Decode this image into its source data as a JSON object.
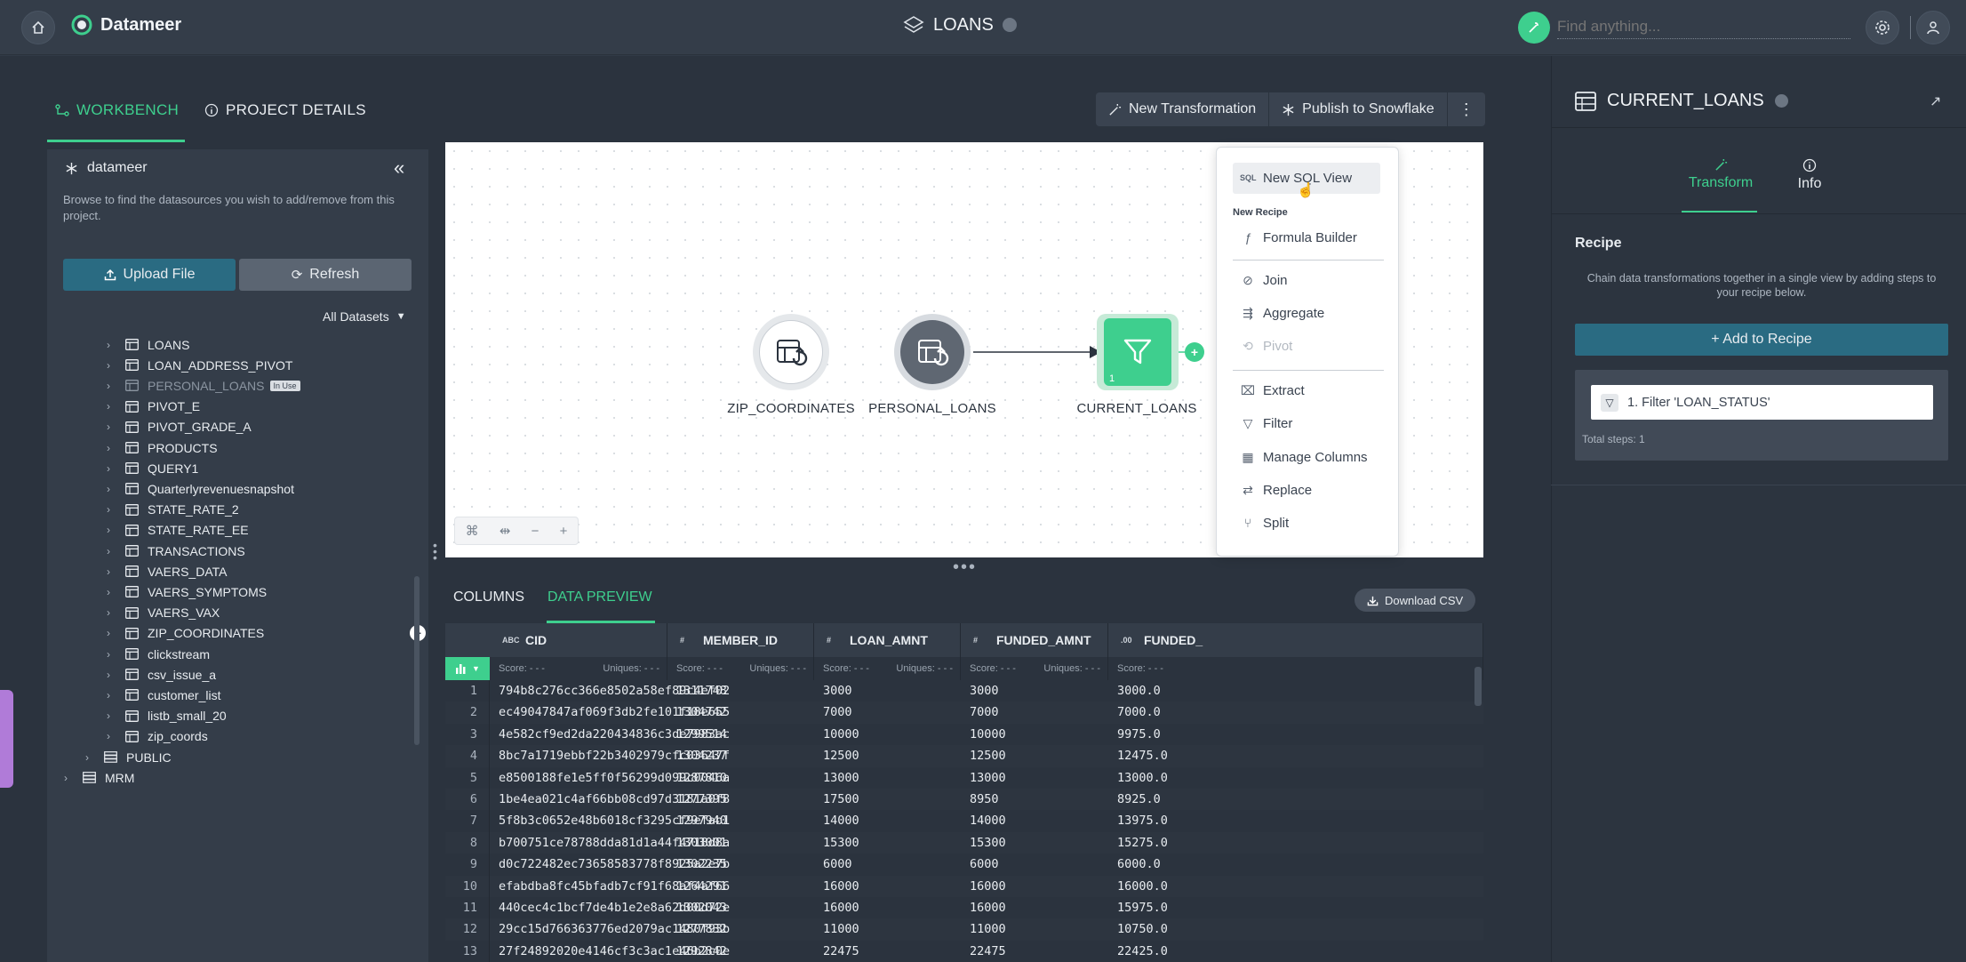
{
  "app": {
    "name": "Datameer",
    "project_title": "LOANS",
    "search_placeholder": "Find anything..."
  },
  "nav": {
    "tabs": [
      {
        "label": "WORKBENCH"
      },
      {
        "label": "PROJECT DETAILS"
      }
    ]
  },
  "toolbar": {
    "new_transformation": "New Transformation",
    "publish": "Publish to Snowflake"
  },
  "sidebar": {
    "title": "datameer",
    "description": "Browse to find the datasources you wish to add/remove from this project.",
    "upload_label": "Upload File",
    "refresh_label": "Refresh",
    "filter_label": "All Datasets",
    "in_use_badge": "In Use",
    "datasets": [
      "LOANS",
      "LOAN_ADDRESS_PIVOT",
      "PERSONAL_LOANS",
      "PIVOT_E",
      "PIVOT_GRADE_A",
      "PRODUCTS",
      "QUERY1",
      "Quarterlyrevenuesnapshot",
      "STATE_RATE_2",
      "STATE_RATE_EE",
      "TRANSACTIONS",
      "VAERS_DATA",
      "VAERS_SYMPTOMS",
      "VAERS_VAX",
      "ZIP_COORDINATES",
      "clickstream",
      "csv_issue_a",
      "customer_list",
      "listb_small_20",
      "zip_coords"
    ],
    "schemas": [
      "PUBLIC",
      "MRM"
    ]
  },
  "canvas": {
    "nodes": [
      {
        "label": "ZIP_COORDINATES"
      },
      {
        "label": "PERSONAL_LOANS"
      },
      {
        "label": "CURRENT_LOANS",
        "badge": "1"
      }
    ],
    "connector_symbol": "+"
  },
  "context_menu": {
    "top_item": "New SQL View",
    "section_label": "New Recipe",
    "items": [
      "Formula Builder",
      "Join",
      "Aggregate",
      "Pivot",
      "Extract",
      "Filter",
      "Manage Columns",
      "Replace",
      "Split"
    ]
  },
  "preview": {
    "tabs": [
      {
        "label": "COLUMNS"
      },
      {
        "label": "DATA PREVIEW"
      }
    ],
    "download_label": "Download CSV",
    "score_label": "Score: - - -",
    "uniques_label": "Uniques: - - -",
    "columns": [
      {
        "type": "ABC",
        "name": "CID"
      },
      {
        "type": "#",
        "name": "MEMBER_ID"
      },
      {
        "type": "#",
        "name": "LOAN_AMNT"
      },
      {
        "type": "#",
        "name": "FUNDED_AMNT"
      },
      {
        "type": ".00",
        "name": "FUNDED_"
      }
    ],
    "rows": [
      [
        "1",
        "794b8c276cc366e8502a58ef89c4ef02",
        "1311748",
        "3000",
        "3000",
        "3000.0"
      ],
      [
        "2",
        "ec49047847af069f3db2fe101f18e655",
        "1304742",
        "7000",
        "7000",
        "7000.0"
      ],
      [
        "3",
        "4e582cf9ed2da220434836c3de7983ac",
        "1299514",
        "10000",
        "10000",
        "9975.0"
      ],
      [
        "4",
        "8bc7a1719ebbf22b3402979cfc03647f",
        "1304237",
        "12500",
        "12500",
        "12475.0"
      ],
      [
        "5",
        "e8500188fe1e5ff0f56299d099c0046a",
        "1287810",
        "13000",
        "13000",
        "13000.0"
      ],
      [
        "6",
        "1be4ea021c4af66bb08cd97d3181a0f8",
        "1277395",
        "17500",
        "8950",
        "8925.0"
      ],
      [
        "7",
        "5f8b3c0652e48b6018cf3295cf9efab1",
        "1297940",
        "14000",
        "14000",
        "13975.0"
      ],
      [
        "8",
        "b700751ce78788dda81d1a44f4718d8a",
        "1303001",
        "15300",
        "15300",
        "15275.0"
      ],
      [
        "9",
        "d0c722482ec73658583778f8925a2e7b",
        "1302235",
        "6000",
        "6000",
        "6000.0"
      ],
      [
        "10",
        "efabdba8fc45bfadb7cf91f68af4af66",
        "1264291",
        "16000",
        "16000",
        "16000.0"
      ],
      [
        "11",
        "440cec4c1bcf7de4b1e2e8a62d00d72e",
        "1302043",
        "16000",
        "16000",
        "15975.0"
      ],
      [
        "12",
        "29cc15d766363776ed2079ac1480f93b",
        "1277832",
        "11000",
        "11000",
        "10750.0"
      ],
      [
        "13",
        "27f24892020e4146cf3c3ac1e46b2c0e",
        "1292842",
        "22475",
        "22475",
        "22425.0"
      ]
    ]
  },
  "right_panel": {
    "title": "CURRENT_LOANS",
    "tabs": [
      {
        "label": "Transform"
      },
      {
        "label": "Info"
      }
    ],
    "section_title": "Recipe",
    "description": "Chain data transformations together in a single view by adding steps to your recipe below.",
    "add_label": "+ Add to Recipe",
    "steps": [
      "1. Filter 'LOAN_STATUS'"
    ],
    "total_steps": "Total steps: 1"
  },
  "colors": {
    "accent": "#3ecf8e",
    "teal_button": "#2a6b82",
    "dark_bg": "#2b333e"
  }
}
